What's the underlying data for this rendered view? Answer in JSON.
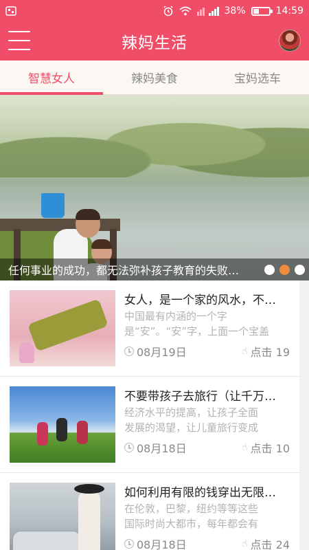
{
  "status_bar": {
    "battery": "38%",
    "battery_level": 0.38,
    "time": "14:59",
    "icons": [
      "screenshot-icon",
      "alarm-icon",
      "wifi-icon",
      "signal-icon",
      "battery-icon"
    ]
  },
  "header": {
    "title": "辣妈生活"
  },
  "tabs": [
    {
      "label": "智慧女人",
      "active": true
    },
    {
      "label": "辣妈美食",
      "active": false
    },
    {
      "label": "宝妈选车",
      "active": false
    }
  ],
  "banner": {
    "caption": "任何事业的成功，都无法弥补孩子教育的失败…",
    "dots": 3,
    "active_dot": 2
  },
  "articles": [
    {
      "title": "女人，是一个家的风水，不…",
      "summary_line1": "中国最有内涵的一个字",
      "summary_line2": "是“安”。“安”字，上面一个宝盖",
      "date": "08月19日",
      "clicks": "点击 19"
    },
    {
      "title": "不要带孩子去旅行（让千万…",
      "summary_line1": "经济水平的提高，让孩子全面",
      "summary_line2": "发展的渴望，让儿童旅行变成",
      "date": "08月18日",
      "clicks": "点击 10"
    },
    {
      "title": "如何利用有限的钱穿出无限…",
      "summary_line1": "在伦敦，巴黎，纽约等等这些",
      "summary_line2": "国际时尚大都市，每年都会有",
      "date": "08月18日",
      "clicks": "点击 24"
    }
  ],
  "colors": {
    "brand": "#f04e68",
    "tab_bg": "#fbf7f2",
    "active_dot": "#f08a3e"
  }
}
